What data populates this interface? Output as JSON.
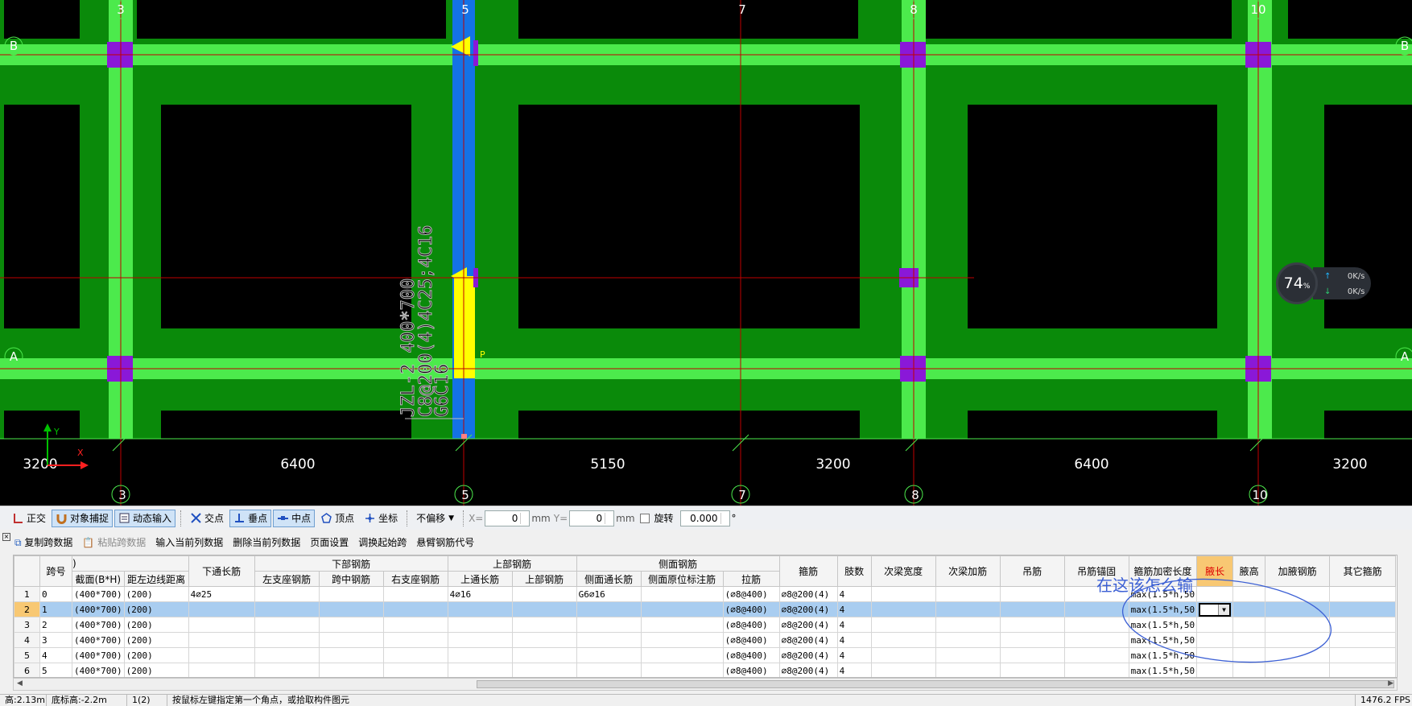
{
  "canvas": {
    "top_grid_labels": [
      "3",
      "5",
      "7",
      "8",
      "10"
    ],
    "row_grid_labels": [
      "B",
      "A"
    ],
    "bottom_dims": [
      "3200",
      "6400",
      "5150",
      "3200",
      "6400",
      "3200"
    ],
    "bottom_grid_labels": [
      "3",
      "5",
      "7",
      "8",
      "10"
    ],
    "beam_annotation_lines": [
      "JZL-2 400*700",
      "C8@200(4)4C25;4C16",
      "G6C16"
    ],
    "small_label": "P",
    "axis_x": "X",
    "axis_y": "Y",
    "gauge": {
      "percent": "74",
      "percent_unit": "%",
      "up_rate": "0K/s",
      "down_rate": "0K/s"
    }
  },
  "snapbar": {
    "ortho": "正交",
    "object_snap": "对象捕捉",
    "dynamic_input": "动态输入",
    "intersection": "交点",
    "perpendicular": "垂点",
    "midpoint": "中点",
    "vertex": "顶点",
    "coordinate": "坐标",
    "offset_mode": "不偏移",
    "x_label": "X=",
    "x_value": "0",
    "x_unit": "mm",
    "y_label": "Y=",
    "y_value": "0",
    "y_unit": "mm",
    "rotate_label": "旋转",
    "rotate_value": "0.000",
    "degree": "°"
  },
  "grid_toolbar": {
    "copy": "复制跨数据",
    "paste": "粘贴跨数据",
    "input_col": "输入当前列数据",
    "delete_col": "删除当前列数据",
    "page_setup": "页面设置",
    "adjust_start": "调换起始跨",
    "cantilever": "悬臂钢筋代号"
  },
  "table": {
    "headers": {
      "span_no": "跨号",
      "section_group": ")",
      "section": "截面(B*H)",
      "left_edge": "距左边线距离",
      "bottom_through": "下通长筋",
      "bottom_rebar": "下部钢筋",
      "left_support": "左支座钢筋",
      "mid_span": "跨中钢筋",
      "right_support": "右支座钢筋",
      "top_rebar": "上部钢筋",
      "top_through": "上通长筋",
      "top_part": "上部钢筋",
      "side_rebar": "侧面钢筋",
      "side_through": "侧面通长筋",
      "side_origin": "侧面原位标注筋",
      "tie": "拉筋",
      "stirrup": "箍筋",
      "legs": "肢数",
      "sec_beam_width": "次梁宽度",
      "sec_beam_add": "次梁加筋",
      "hanger": "吊筋",
      "hanger_anchor": "吊筋锚固",
      "stirrup_dense": "箍筋加密长度",
      "haunch_len": "腋长",
      "haunch_h": "腋高",
      "haunch_rebar": "加腋钢筋",
      "other_stirrup": "其它箍筋"
    },
    "rows": [
      {
        "n": "1",
        "span": "0",
        "section": "(400*700)",
        "dist": "(200)",
        "bt": "4⌀25",
        "ls": "",
        "ms": "",
        "rs": "",
        "tt": "4⌀16",
        "tp": "",
        "st": "G6⌀16",
        "so": "",
        "tie": "(⌀8@400)",
        "stirrup": "⌀8@200(4)",
        "legs": "4",
        "dense": "max(1.5*h,50"
      },
      {
        "n": "2",
        "span": "1",
        "section": "(400*700)",
        "dist": "(200)",
        "bt": "",
        "ls": "",
        "ms": "",
        "rs": "",
        "tt": "",
        "tp": "",
        "st": "",
        "so": "",
        "tie": "(⌀8@400)",
        "stirrup": "⌀8@200(4)",
        "legs": "4",
        "dense": "max(1.5*h,50"
      },
      {
        "n": "3",
        "span": "2",
        "section": "(400*700)",
        "dist": "(200)",
        "bt": "",
        "ls": "",
        "ms": "",
        "rs": "",
        "tt": "",
        "tp": "",
        "st": "",
        "so": "",
        "tie": "(⌀8@400)",
        "stirrup": "⌀8@200(4)",
        "legs": "4",
        "dense": "max(1.5*h,50"
      },
      {
        "n": "4",
        "span": "3",
        "section": "(400*700)",
        "dist": "(200)",
        "bt": "",
        "ls": "",
        "ms": "",
        "rs": "",
        "tt": "",
        "tp": "",
        "st": "",
        "so": "",
        "tie": "(⌀8@400)",
        "stirrup": "⌀8@200(4)",
        "legs": "4",
        "dense": "max(1.5*h,50"
      },
      {
        "n": "5",
        "span": "4",
        "section": "(400*700)",
        "dist": "(200)",
        "bt": "",
        "ls": "",
        "ms": "",
        "rs": "",
        "tt": "",
        "tp": "",
        "st": "",
        "so": "",
        "tie": "(⌀8@400)",
        "stirrup": "⌀8@200(4)",
        "legs": "4",
        "dense": "max(1.5*h,50"
      },
      {
        "n": "6",
        "span": "5",
        "section": "(400*700)",
        "dist": "(200)",
        "bt": "",
        "ls": "",
        "ms": "",
        "rs": "",
        "tt": "",
        "tp": "",
        "st": "",
        "so": "",
        "tie": "(⌀8@400)",
        "stirrup": "⌀8@200(4)",
        "legs": "4",
        "dense": "max(1.5*h,50"
      }
    ]
  },
  "annotation": {
    "text": "在这该怎么输"
  },
  "statusbar": {
    "height": "高:2.13m",
    "bottom_elev": "底标高:-2.2m",
    "count": "1(2)",
    "hint": "按鼠标左键指定第一个角点，或拾取构件图元",
    "fps": "1476.2 FPS"
  },
  "colors": {
    "beam_green": "#4cea4c",
    "slab_green": "#0a8a0a",
    "column": "#8a18d8",
    "selected_beam": "#1472e6",
    "highlight_yellow": "#ffff00",
    "grid_line": "#c00000",
    "selected_row": "#a9cdf0",
    "annotation_blue": "#3b5fd4"
  }
}
